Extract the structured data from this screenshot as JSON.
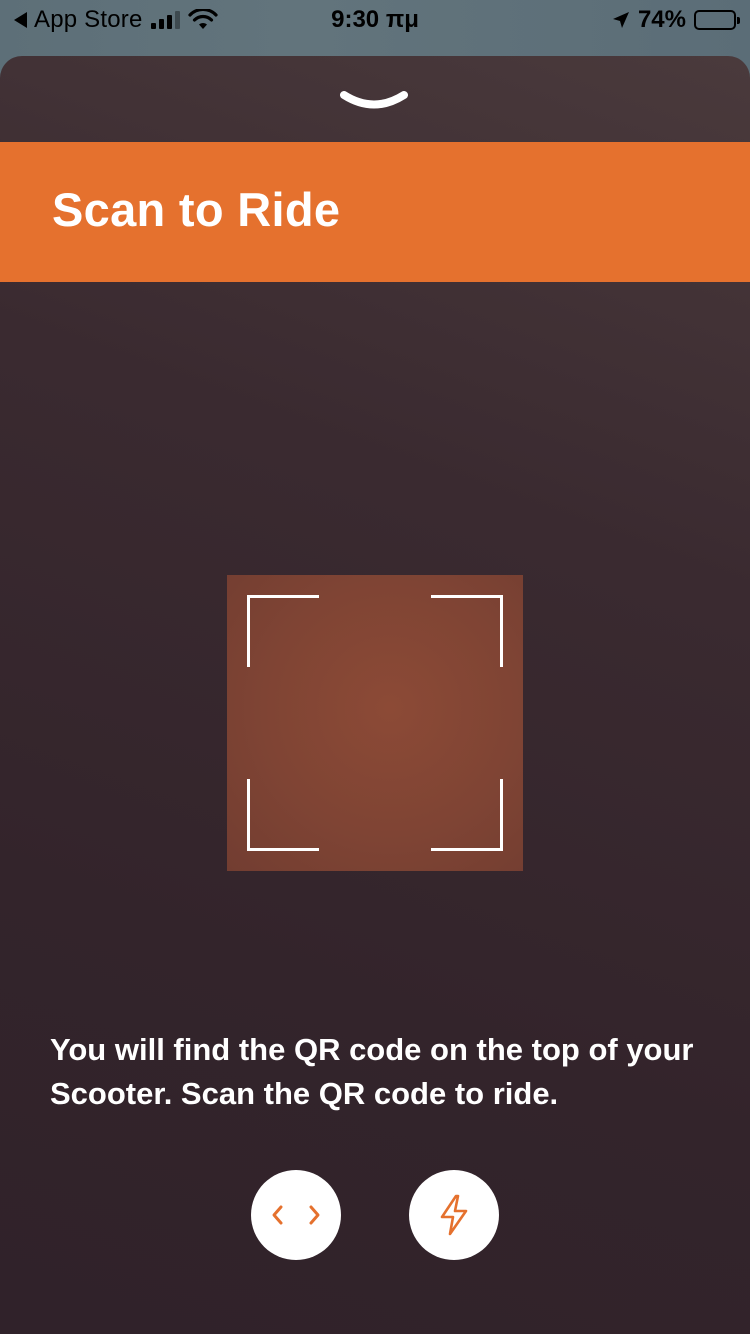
{
  "status_bar": {
    "back_app": "App Store",
    "time": "9:30 πμ",
    "battery_percent": "74%",
    "battery_level": 0.74
  },
  "sheet": {
    "title": "Scan to Ride",
    "instructions": "You will find the QR code on the top of your Scooter. Scan the QR code to ride."
  },
  "colors": {
    "accent": "#e5712e",
    "sheet_bg": "#33242b",
    "camera_preview": "#7f4434"
  },
  "icons": {
    "collapse": "chevron-down-icon",
    "manual_code": "code-icon",
    "flashlight": "flash-icon"
  }
}
